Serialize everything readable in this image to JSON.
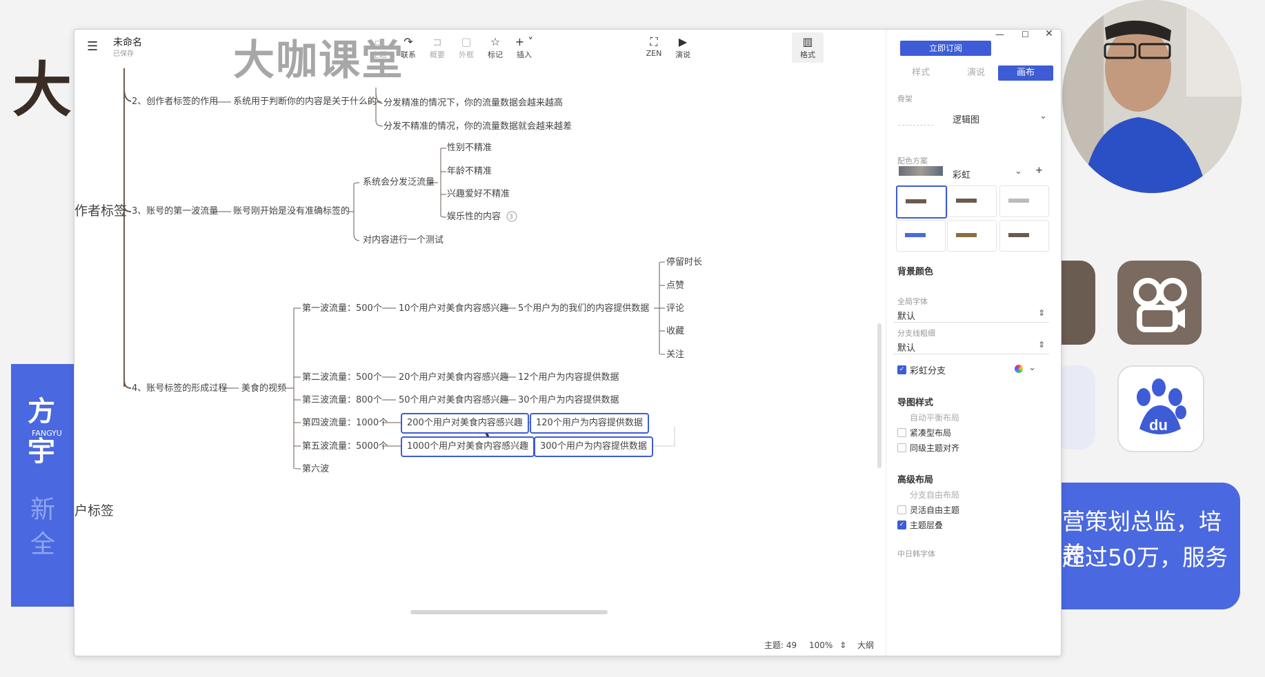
{
  "background": {
    "big_char": "大",
    "blue_panel": {
      "title": "方宇",
      "subtitle": "FANGYU",
      "line1": "新",
      "line2": "全"
    },
    "right_card": {
      "line1": "营策划总监，培养",
      "line2": "超过50万，服务"
    },
    "behind_labels": {
      "label1": "作者标签",
      "label2": "户标签"
    }
  },
  "window": {
    "file_title": "未命名",
    "file_status": "已保存",
    "watermark": "大咖课堂",
    "toolbar": [
      {
        "label": "主题",
        "icon": "topic-icon",
        "glyph": "▭",
        "dim": true
      },
      {
        "label": "联系",
        "icon": "relation-icon",
        "glyph": "↷",
        "dim": false
      },
      {
        "label": "概要",
        "icon": "summary-icon",
        "glyph": "⊐",
        "dim": true
      },
      {
        "label": "外框",
        "icon": "boundary-icon",
        "glyph": "▢",
        "dim": true
      },
      {
        "label": "标记",
        "icon": "star-icon",
        "glyph": "☆",
        "dim": false
      },
      {
        "label": "插入",
        "icon": "plus-icon",
        "glyph": "+ ˅",
        "dim": false
      }
    ],
    "toolbar_right": [
      {
        "label": "ZEN",
        "icon": "zen-icon",
        "glyph": "⛶"
      },
      {
        "label": "演说",
        "icon": "present-icon",
        "glyph": "▶"
      }
    ],
    "format_button": "格式"
  },
  "mindmap": {
    "root_label": "作者标签",
    "root_label2": "户标签",
    "b2": {
      "label": "2、创作者标签的作用",
      "child": "系统用于判断你的内容是关于什么的",
      "leaf1": "分发精准的情况下，你的流量数据会越来越高",
      "leaf2": "分发不精准的情况，你的流量数据就会越来越差"
    },
    "b3": {
      "label": "3、账号的第一波流量",
      "child": "账号刚开始是没有准确标签的",
      "sub1": "系统会分发泛流量",
      "sub1_items": [
        "性别不精准",
        "年龄不精准",
        "兴趣爱好不精准",
        "娱乐性的内容"
      ],
      "collapsed_count": "3",
      "sub2": "对内容进行一个测试"
    },
    "b4": {
      "label": "4、账号标签的形成过程",
      "child": "美食的视频",
      "waves": [
        {
          "wave": "第一波流量：500个",
          "interest": "10个用户对美食内容感兴趣",
          "data": "5个用户为的我们的内容提供数据"
        },
        {
          "wave": "第二波流量：500个",
          "interest": "20个用户对美食内容感兴趣",
          "data": "12个用户为内容提供数据"
        },
        {
          "wave": "第三波流量：800个",
          "interest": "50个用户对美食内容感兴趣",
          "data": "30个用户为内容提供数据"
        },
        {
          "wave": "第四波流量：1000个",
          "interest": "200个用户对美食内容感兴趣",
          "data": "120个用户为内容提供数据"
        },
        {
          "wave": "第五波流量：5000个",
          "interest": "1000个用户对美食内容感兴趣",
          "data": "300个用户为内容提供数据"
        },
        {
          "wave": "第六波",
          "interest": "",
          "data": ""
        }
      ],
      "metrics": [
        "停留时长",
        "点赞",
        "评论",
        "收藏",
        "关注"
      ]
    }
  },
  "sidebar": {
    "subscribe": "立即订阅",
    "tabs": [
      "样式",
      "演说",
      "画布"
    ],
    "skeleton_label": "骨架",
    "skeleton_value": "逻辑图",
    "color_scheme_label": "配色方案",
    "color_scheme_value": "彩虹",
    "bg_color_label": "背景颜色",
    "global_font_label": "全局字体",
    "global_font_value": "默认",
    "branch_width_label": "分支线粗细",
    "branch_width_value": "默认",
    "rainbow_branch": "彩虹分支",
    "map_style_label": "导图样式",
    "auto_balance": "自动平衡布局",
    "compact": "紧凑型布局",
    "align_same": "同级主题对齐",
    "advanced_label": "高级布局",
    "free_layout": "分支自由布局",
    "flexible_free": "灵活自由主题",
    "overlap": "主题层叠",
    "cjk_font": "中日韩字体"
  },
  "status": {
    "topics": "主题: 49",
    "zoom": "100%",
    "outline": "大纲"
  },
  "colors": {
    "accent": "#3d5cd6",
    "branch": "#6b5a4d",
    "blue_panel": "#4a68e0"
  }
}
